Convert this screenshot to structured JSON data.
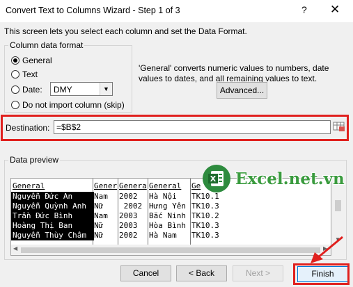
{
  "window": {
    "title": "Convert Text to Columns Wizard - Step 1 of 3",
    "help_glyph": "?",
    "close_glyph": "✕"
  },
  "intro_text": "This screen lets you select each column and set the Data Format.",
  "column_format": {
    "label": "Column data format",
    "options": [
      {
        "label": "General",
        "checked": true
      },
      {
        "label": "Text",
        "checked": false
      },
      {
        "label": "Date:",
        "checked": false
      },
      {
        "label": "Do not import column (skip)",
        "checked": false
      }
    ],
    "date_value": "DMY"
  },
  "description": "'General' converts numeric values to numbers, date values to dates, and all remaining values to text.",
  "advanced_label": "Advanced...",
  "destination": {
    "label": "Destination:",
    "value": "=$B$2"
  },
  "preview": {
    "label": "Data preview",
    "headers": [
      "General",
      "Gener",
      "Genera",
      "General",
      "Ge"
    ],
    "rows": [
      [
        "Nguyễn Đức An",
        "Nam",
        "2002",
        "Hà Nội",
        "TK10.1"
      ],
      [
        "Nguyễn Quỳnh Anh",
        "Nữ",
        " 2002",
        "Hưng Yên",
        "TK10.3"
      ],
      [
        "Trần Đức Bình",
        "Nam",
        "2003",
        "Bắc Ninh",
        "TK10.2"
      ],
      [
        "Hoàng Thị Ban",
        "Nữ",
        "2003",
        "Hòa Bình",
        "TK10.3"
      ],
      [
        "Nguyễn Thùy Châm",
        "Nữ",
        "2002",
        "Hà Nam",
        "TK10.3"
      ]
    ]
  },
  "watermark": "Excel.net.vn",
  "buttons": {
    "cancel": "Cancel",
    "back": "< Back",
    "next": "Next >",
    "finish": "Finish"
  },
  "colors": {
    "highlight_red": "#e0201e",
    "logo_green": "#3a9b3e"
  }
}
